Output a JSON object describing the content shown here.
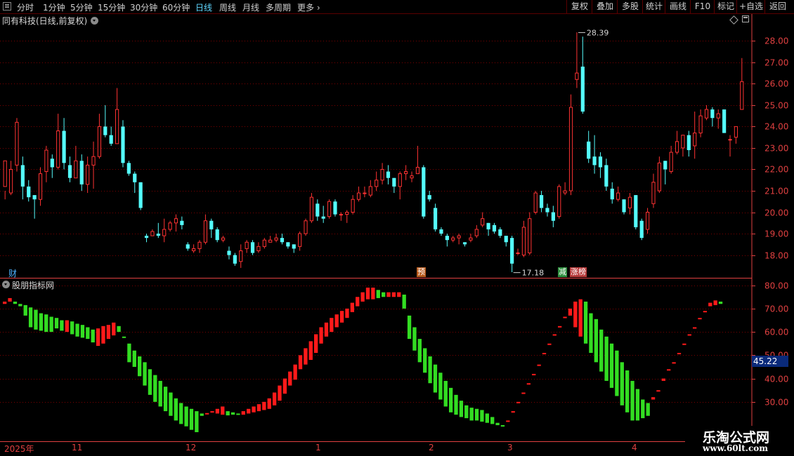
{
  "toolbar": {
    "tabs": [
      "分时",
      "1分钟",
      "5分钟",
      "15分钟",
      "30分钟",
      "60分钟",
      "日线",
      "周线",
      "月线",
      "多周期",
      "更多"
    ],
    "active_tab": "日线",
    "right_buttons": [
      "复权",
      "叠加",
      "多股",
      "统计",
      "画线",
      "F10",
      "标记",
      "+自选",
      "返回"
    ]
  },
  "stock": {
    "title": "同有科技(日线,前复权)"
  },
  "indicator": {
    "title": "股朋指标网",
    "current_value": "45.22"
  },
  "tags": {
    "cai": "财",
    "yu": "预",
    "jian": "减",
    "zt": "涨榜"
  },
  "watermark": {
    "name": "乐淘公式网",
    "url": "www.60lt.com"
  },
  "dates": [
    "2025年",
    "11",
    "12",
    "1",
    "2",
    "3",
    "4"
  ],
  "colors": {
    "up": "#ff3232",
    "down": "#54fcfc",
    "ind_up": "#ff1a1a",
    "ind_down": "#33dd22",
    "grid": "#7a0000",
    "axis": "#e04040"
  },
  "chart_data": [
    {
      "type": "candlestick",
      "title": "同有科技(日线,前复权)",
      "ylim": [
        17.2,
        28.6
      ],
      "yticks": [
        18.0,
        19.0,
        20.0,
        21.0,
        22.0,
        23.0,
        24.0,
        25.0,
        26.0,
        27.0,
        28.0
      ],
      "annotations": [
        {
          "label": "28.39",
          "value": 28.39
        },
        {
          "label": "17.18",
          "value": 17.18
        }
      ],
      "candles": [
        [
          21.2,
          22.4,
          21.0,
          20.6
        ],
        [
          20.9,
          22.0,
          22.4,
          20.8
        ],
        [
          22.2,
          24.2,
          24.4,
          21.9
        ],
        [
          22.2,
          21.2,
          22.6,
          20.6
        ],
        [
          21.2,
          20.7,
          21.5,
          20.5
        ],
        [
          20.8,
          20.6,
          20.8,
          19.7
        ],
        [
          20.6,
          21.8,
          22.1,
          20.3
        ],
        [
          21.9,
          22.9,
          23.1,
          21.4
        ],
        [
          22.5,
          22.1,
          22.7,
          21.6
        ],
        [
          22.1,
          23.8,
          24.6,
          22.0
        ],
        [
          23.8,
          22.3,
          24.4,
          22.0
        ],
        [
          22.2,
          21.6,
          22.6,
          21.4
        ],
        [
          21.6,
          22.4,
          23.1,
          21.6
        ],
        [
          22.4,
          21.3,
          22.7,
          21.0
        ],
        [
          21.3,
          22.2,
          22.6,
          20.9
        ],
        [
          22.2,
          22.6,
          23.3,
          21.1
        ],
        [
          22.6,
          24.0,
          24.6,
          22.5
        ],
        [
          24.0,
          23.6,
          25.0,
          23.5
        ],
        [
          23.6,
          23.2,
          24.0,
          23.1
        ],
        [
          23.2,
          24.8,
          25.8,
          23.2
        ],
        [
          24.0,
          22.3,
          24.3,
          22.1
        ],
        [
          22.3,
          21.8,
          22.4,
          21.7
        ],
        [
          21.8,
          21.4,
          21.9,
          20.9
        ],
        [
          21.4,
          20.2,
          21.4,
          20.1
        ],
        [
          18.9,
          18.8,
          19.0,
          18.6
        ],
        [
          18.9,
          19.1,
          19.2,
          18.9
        ],
        [
          19.0,
          18.9,
          19.5,
          18.8
        ],
        [
          18.9,
          19.2,
          19.7,
          18.6
        ],
        [
          19.2,
          19.5,
          19.6,
          19.1
        ],
        [
          19.5,
          19.7,
          19.9,
          19.1
        ],
        [
          19.6,
          19.4,
          19.8,
          19.2
        ],
        [
          18.5,
          18.3,
          18.6,
          18.2
        ],
        [
          18.2,
          18.3,
          18.5,
          18.1
        ],
        [
          18.3,
          18.6,
          18.7,
          18.1
        ],
        [
          18.6,
          19.6,
          19.9,
          18.5
        ],
        [
          19.6,
          19.2,
          19.7,
          18.8
        ],
        [
          19.2,
          18.7,
          19.3,
          18.6
        ],
        [
          18.7,
          18.8,
          18.9,
          18.6
        ],
        [
          18.2,
          18.0,
          18.4,
          17.8
        ],
        [
          18.0,
          17.6,
          18.1,
          17.5
        ],
        [
          17.7,
          18.2,
          18.5,
          17.4
        ],
        [
          18.3,
          18.6,
          18.7,
          18.1
        ],
        [
          18.6,
          18.1,
          18.7,
          18.0
        ],
        [
          18.2,
          18.4,
          18.6,
          18.1
        ],
        [
          18.4,
          18.7,
          18.8,
          18.3
        ],
        [
          18.6,
          18.7,
          18.9,
          18.6
        ],
        [
          18.7,
          18.8,
          19.0,
          18.6
        ],
        [
          18.8,
          18.6,
          19.0,
          18.5
        ],
        [
          18.6,
          18.4,
          18.6,
          18.3
        ],
        [
          18.5,
          18.3,
          18.5,
          18.1
        ],
        [
          18.4,
          19.0,
          19.1,
          18.2
        ],
        [
          19.0,
          19.6,
          19.7,
          18.9
        ],
        [
          19.6,
          20.7,
          20.9,
          19.5
        ],
        [
          20.4,
          19.8,
          20.6,
          19.6
        ],
        [
          19.8,
          19.7,
          20.3,
          19.5
        ],
        [
          19.8,
          20.5,
          20.6,
          19.7
        ],
        [
          20.5,
          19.9,
          20.6,
          19.8
        ],
        [
          19.9,
          19.9,
          20.0,
          19.6
        ],
        [
          19.9,
          20.0,
          20.1,
          19.5
        ],
        [
          20.0,
          20.6,
          20.8,
          19.9
        ],
        [
          20.6,
          20.9,
          21.2,
          20.5
        ],
        [
          20.9,
          20.9,
          21.2,
          20.7
        ],
        [
          20.8,
          21.2,
          21.5,
          20.7
        ],
        [
          21.2,
          21.5,
          21.9,
          21.0
        ],
        [
          21.5,
          22.0,
          22.3,
          21.3
        ],
        [
          21.9,
          21.6,
          22.2,
          21.3
        ],
        [
          21.6,
          21.2,
          21.6,
          20.9
        ],
        [
          21.2,
          21.8,
          21.9,
          20.6
        ],
        [
          21.8,
          21.9,
          22.2,
          21.5
        ],
        [
          21.6,
          21.7,
          21.9,
          21.4
        ],
        [
          21.8,
          22.1,
          23.1,
          21.8
        ],
        [
          22.1,
          19.8,
          22.2,
          19.7
        ],
        [
          20.8,
          20.6,
          21.0,
          20.5
        ],
        [
          20.2,
          19.2,
          20.4,
          19.1
        ],
        [
          19.2,
          19.0,
          19.3,
          18.9
        ],
        [
          18.9,
          18.7,
          19.0,
          18.4
        ],
        [
          18.7,
          18.8,
          18.9,
          18.6
        ],
        [
          18.8,
          18.9,
          19.0,
          18.5
        ],
        [
          18.6,
          18.5,
          18.6,
          18.4
        ],
        [
          18.7,
          18.8,
          19.0,
          18.6
        ],
        [
          18.9,
          19.2,
          19.4,
          18.8
        ],
        [
          19.4,
          19.7,
          20.0,
          19.3
        ],
        [
          19.5,
          19.2,
          19.5,
          18.9
        ],
        [
          19.4,
          19.1,
          19.5,
          19.0
        ],
        [
          19.2,
          18.9,
          19.3,
          18.8
        ],
        [
          18.9,
          18.6,
          18.9,
          18.4
        ],
        [
          18.8,
          17.6,
          18.9,
          17.2
        ],
        [
          18.1,
          18.1,
          18.3,
          18.0
        ],
        [
          18.0,
          19.3,
          19.6,
          17.9
        ],
        [
          18.1,
          19.7,
          20.0,
          18.0
        ],
        [
          20.0,
          20.9,
          21.0,
          19.9
        ],
        [
          20.8,
          20.2,
          21.0,
          20.0
        ],
        [
          20.2,
          20.0,
          20.4,
          19.8
        ],
        [
          20.0,
          19.6,
          20.3,
          19.3
        ],
        [
          19.8,
          21.2,
          21.3,
          19.7
        ],
        [
          20.9,
          21.0,
          21.4,
          20.8
        ],
        [
          21.0,
          24.9,
          25.5,
          20.8
        ],
        [
          26.2,
          26.5,
          28.4,
          25.8
        ],
        [
          26.8,
          24.7,
          28.2,
          24.6
        ],
        [
          23.3,
          22.5,
          23.8,
          22.3
        ],
        [
          22.6,
          22.2,
          23.6,
          21.8
        ],
        [
          22.6,
          22.1,
          22.8,
          21.6
        ],
        [
          22.2,
          21.2,
          22.5,
          21.0
        ],
        [
          21.1,
          20.6,
          21.4,
          20.4
        ],
        [
          20.6,
          20.9,
          21.2,
          20.5
        ],
        [
          20.6,
          20.0,
          20.6,
          19.9
        ],
        [
          20.2,
          20.7,
          20.9,
          19.9
        ],
        [
          20.8,
          19.3,
          20.8,
          19.2
        ],
        [
          19.6,
          18.8,
          19.7,
          18.7
        ],
        [
          19.2,
          20.0,
          20.2,
          19.0
        ],
        [
          20.4,
          21.4,
          21.8,
          20.2
        ],
        [
          21.0,
          22.3,
          22.6,
          20.9
        ],
        [
          22.4,
          22.0,
          22.4,
          21.3
        ],
        [
          21.9,
          22.8,
          23.1,
          21.8
        ],
        [
          22.8,
          23.3,
          23.8,
          22.7
        ],
        [
          23.0,
          23.6,
          23.6,
          22.6
        ],
        [
          23.6,
          22.9,
          23.8,
          22.6
        ],
        [
          23.1,
          23.7,
          24.7,
          22.5
        ],
        [
          23.7,
          24.5,
          24.8,
          23.5
        ],
        [
          24.4,
          24.8,
          25.0,
          24.3
        ],
        [
          24.8,
          24.4,
          24.9,
          24.0
        ],
        [
          24.4,
          24.6,
          24.8,
          23.9
        ],
        [
          24.8,
          23.7,
          24.8,
          23.7
        ],
        [
          23.4,
          23.4,
          23.6,
          22.6
        ],
        [
          23.5,
          24.0,
          24.0,
          23.2
        ],
        [
          24.8,
          26.1,
          27.2,
          24.8
        ]
      ]
    },
    {
      "type": "bar",
      "title": "股朋指标网",
      "ylim": [
        14,
        82
      ],
      "yticks": [
        30,
        40,
        50,
        60,
        70,
        80
      ],
      "values_top": [
        73,
        74.5,
        73,
        72,
        71.5,
        70.5,
        69.5,
        68,
        67.5,
        66.5,
        66,
        65,
        65,
        64.5,
        63.5,
        63,
        62,
        61,
        61.5,
        62.5,
        63,
        64,
        62.5,
        58,
        55,
        52,
        49.5,
        47,
        44,
        41.5,
        39,
        36.5,
        34,
        31.5,
        29.5,
        28,
        27,
        26,
        25,
        25.2,
        26,
        27,
        28,
        26,
        25.5,
        25,
        26,
        27,
        28,
        29,
        30,
        31.5,
        34,
        37,
        40,
        43,
        46,
        50,
        53,
        56,
        59,
        62,
        64,
        66,
        67.5,
        69,
        70,
        72.5,
        75,
        77,
        79,
        79,
        78,
        77,
        77,
        77,
        77,
        76,
        67,
        62,
        57,
        53,
        49.5,
        46,
        42.5,
        39,
        36,
        33,
        30.5,
        28.5,
        27.5,
        27,
        26.5,
        25,
        23.5,
        21,
        20,
        22,
        26,
        30,
        34,
        38,
        42,
        46,
        51,
        55,
        59,
        62.5,
        66.5,
        70,
        73,
        74,
        73,
        68,
        65.5,
        61,
        58,
        55,
        52,
        47,
        43.5,
        39,
        35.5,
        31,
        29.5,
        32,
        35,
        40,
        44,
        47,
        51,
        55,
        59,
        62,
        66,
        69,
        72.5,
        73.5,
        73,
        74,
        77
      ],
      "values_bottom": [
        72,
        73,
        72,
        71,
        67,
        62,
        61,
        60.5,
        60,
        60,
        61.5,
        60.5,
        60,
        59,
        58,
        57.5,
        57,
        55.5,
        54,
        55,
        57,
        58.5,
        60,
        57.5,
        47,
        45,
        41,
        37,
        33,
        30,
        28,
        26,
        24,
        22,
        20.5,
        19.5,
        18,
        17,
        24,
        26,
        25.5,
        25,
        24.5,
        24.2,
        24.5,
        24.5,
        24.5,
        25,
        25.5,
        26,
        26.5,
        27,
        28.5,
        30.5,
        33.5,
        37,
        39.5,
        44,
        46,
        48,
        51,
        55,
        58,
        60,
        62,
        64,
        66,
        68.5,
        71,
        73,
        74,
        74,
        74.5,
        75,
        75,
        75,
        75,
        70,
        57,
        52,
        47,
        42.5,
        38,
        34,
        31,
        28,
        25.5,
        24.5,
        23.5,
        23,
        22,
        22,
        21.5,
        21,
        20.5,
        20,
        20,
        23.5,
        29,
        31,
        36,
        41,
        46,
        52.5,
        54,
        58,
        62,
        66.5,
        69,
        67,
        62,
        58,
        55,
        51,
        47,
        43,
        39,
        36,
        32.5,
        28.5,
        25.5,
        22,
        22,
        23,
        24,
        31,
        35,
        39,
        44,
        48,
        54,
        58,
        63.5,
        66.5,
        68.5,
        70,
        71,
        71.5,
        72
      ]
    }
  ]
}
